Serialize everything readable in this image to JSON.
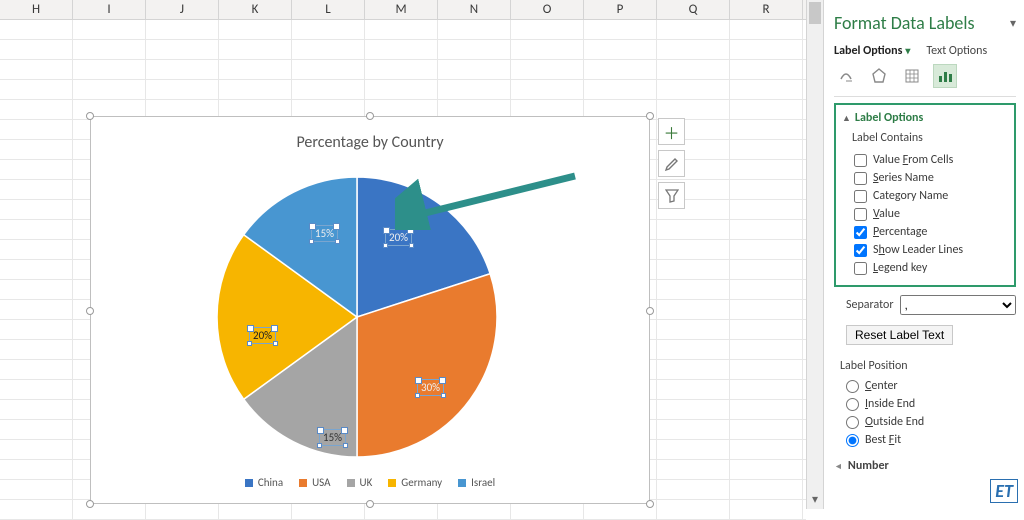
{
  "columns": [
    "H",
    "I",
    "J",
    "K",
    "L",
    "M",
    "N",
    "O",
    "P",
    "Q",
    "R"
  ],
  "chart": {
    "title": "Percentage by Country"
  },
  "chart_data": {
    "type": "pie",
    "title": "Percentage by Country",
    "series": [
      {
        "name": "China",
        "value": 20,
        "label": "20%",
        "color": "#3a75c4"
      },
      {
        "name": "USA",
        "value": 30,
        "label": "30%",
        "color": "#e97b2e"
      },
      {
        "name": "UK",
        "value": 15,
        "label": "15%",
        "color": "#a5a5a5"
      },
      {
        "name": "Germany",
        "value": 20,
        "label": "20%",
        "color": "#f7b500"
      },
      {
        "name": "Israel",
        "value": 15,
        "label": "15%",
        "color": "#4896d1"
      }
    ],
    "legend_position": "bottom",
    "data_labels": "percentage"
  },
  "chart_buttons": {
    "elements": "＋",
    "styles_hint": "brush",
    "filters_hint": "funnel"
  },
  "pane": {
    "title": "Format Data Labels",
    "subtabs": {
      "label_options": "Label Options",
      "text_options": "Text Options"
    },
    "section_label_options": "Label Options",
    "label_contains": "Label Contains",
    "opts": {
      "value_from_cells": "Value From Cells",
      "series_name": "Series Name",
      "category_name": "Category Name",
      "value": "Value",
      "percentage": "Percentage",
      "show_leader": "Show Leader Lines",
      "legend_key": "Legend key"
    },
    "separator_label": "Separator",
    "separator_value": ",",
    "reset_label": "Reset Label Text",
    "label_position": "Label Position",
    "position": {
      "center": "Center",
      "inside_end": "Inside End",
      "outside_end": "Outside End",
      "best_fit": "Best Fit"
    },
    "number": "Number"
  },
  "logo": "ET"
}
